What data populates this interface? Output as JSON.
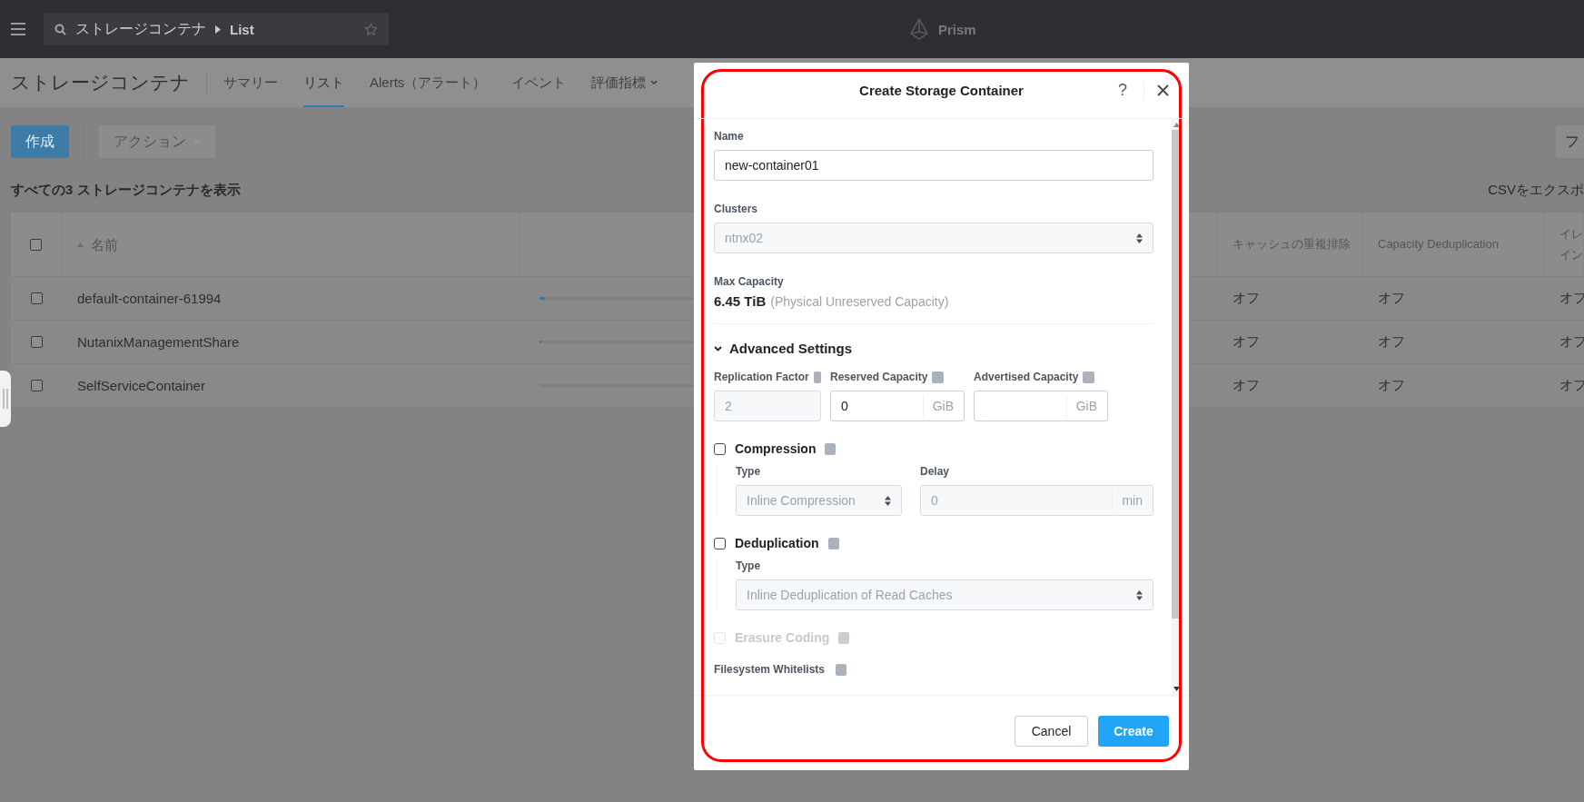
{
  "top_bar": {
    "search_path": "ストレージコンテナ",
    "search_current": "List",
    "brand": "Prism"
  },
  "page": {
    "title": "ストレージコンテナ",
    "tabs": [
      {
        "label": "サマリー",
        "selected": false,
        "kind": "link"
      },
      {
        "label": "リスト",
        "selected": true,
        "kind": "link"
      },
      {
        "label": "Alerts（アラート）",
        "selected": false,
        "kind": "link"
      },
      {
        "label": "イベント",
        "selected": false,
        "kind": "link"
      },
      {
        "label": "評価指標",
        "selected": false,
        "kind": "dropdown"
      }
    ]
  },
  "toolbar": {
    "create_button": "作成",
    "actions_button": "アクション",
    "actions_disabled": true,
    "filter_button": "フ"
  },
  "summary": "すべての3 ストレージコンテナを表示",
  "export_link": "CSVをエクスポ",
  "table": {
    "all_checked": false,
    "name_column": {
      "label": "名前",
      "sorted": true
    },
    "columns": [
      {
        "lines": [
          "キャッシュの重複排除"
        ]
      },
      {
        "lines": [
          "Capacity Deduplication"
        ]
      },
      {
        "lines": [
          "イレ",
          "イン"
        ]
      }
    ],
    "rows": [
      {
        "name": "default-container-61994",
        "checked": false,
        "level": 0.015,
        "cells": [
          "オフ",
          "オフ",
          "オフ"
        ]
      },
      {
        "name": "NutanixManagementShare",
        "checked": false,
        "level": 0.004,
        "cells": [
          "オフ",
          "オフ",
          "オフ"
        ]
      },
      {
        "name": "SelfServiceContainer",
        "checked": false,
        "cells": [
          "オフ",
          "オフ",
          "オフ"
        ]
      }
    ]
  },
  "dialog": {
    "title": "Create Storage Container",
    "help": "?",
    "name": {
      "label": "Name",
      "value": "new-container01"
    },
    "clusters": {
      "label": "Clusters",
      "value": "ntnx02",
      "disabled": true
    },
    "max_capacity": {
      "label": "Max Capacity",
      "value": "6.45 TiB",
      "note": "(Physical Unreserved Capacity)"
    },
    "advanced": {
      "label": "Advanced Settings",
      "expanded": true
    },
    "capacity_fields": [
      {
        "label": "Replication Factor",
        "value": "2",
        "disabled": true
      },
      {
        "label": "Reserved Capacity",
        "value": "0",
        "unit": "GiB",
        "disabled": false
      },
      {
        "label": "Advertised Capacity",
        "unit": "GiB",
        "disabled": false
      }
    ],
    "compression": {
      "label": "Compression",
      "checked": false,
      "type": {
        "label": "Type",
        "value": "Inline Compression",
        "disabled": true
      },
      "delay": {
        "label": "Delay",
        "value": "0",
        "unit": "min",
        "disabled": true
      }
    },
    "deduplication": {
      "label": "Deduplication",
      "checked": false,
      "type": {
        "label": "Type",
        "value": "Inline Deduplication of Read Caches",
        "disabled": true
      }
    },
    "erasure_coding": {
      "label": "Erasure Coding",
      "checked": false,
      "disabled": true
    },
    "whitelists": {
      "label": "Filesystem Whitelists"
    },
    "cancel_button": "Cancel",
    "create_button": "Create"
  }
}
